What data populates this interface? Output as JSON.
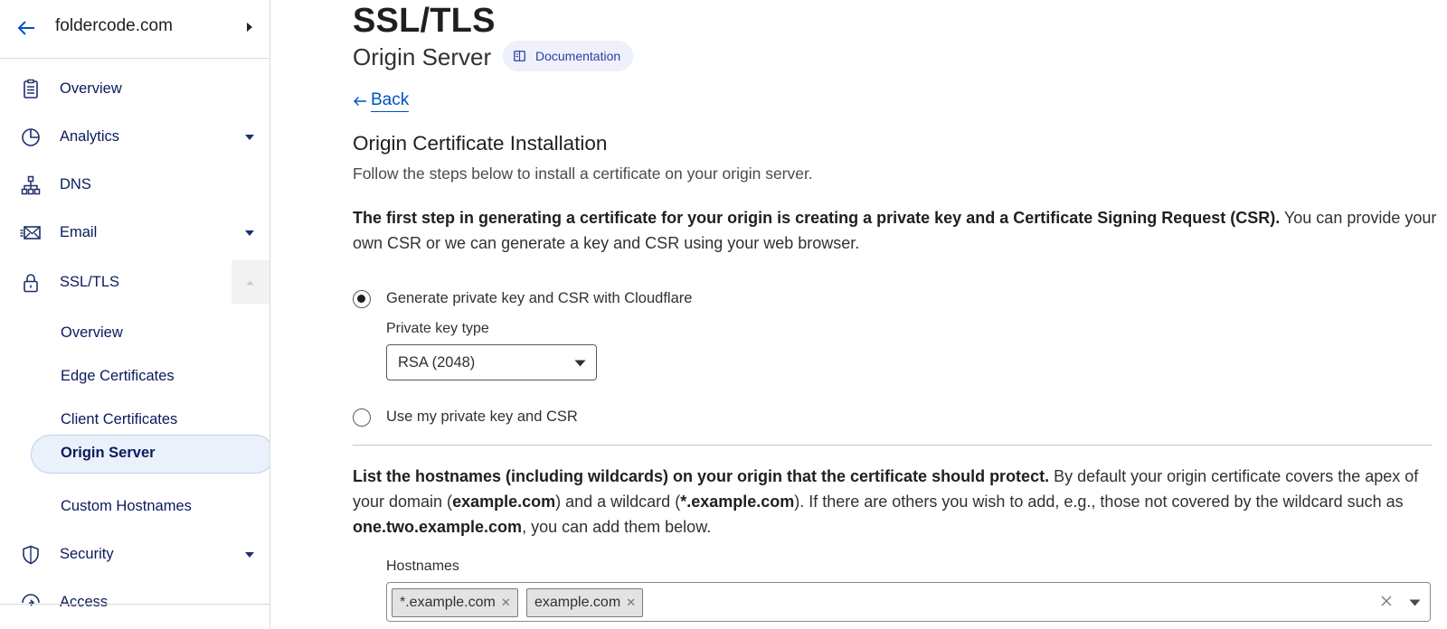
{
  "sidebar": {
    "zone_name": "foldercode.com",
    "items": [
      {
        "label": "Overview",
        "icon": "document-icon"
      },
      {
        "label": "Analytics",
        "icon": "pie-chart-icon"
      },
      {
        "label": "DNS",
        "icon": "network-icon"
      },
      {
        "label": "Email",
        "icon": "mail-icon"
      },
      {
        "label": "SSL/TLS",
        "icon": "lock-icon"
      },
      {
        "label": "Security",
        "icon": "shield-icon"
      },
      {
        "label": "Access",
        "icon": "access-icon"
      }
    ],
    "ssl_subitems": [
      {
        "label": "Overview"
      },
      {
        "label": "Edge Certificates"
      },
      {
        "label": "Client Certificates"
      },
      {
        "label": "Origin Server"
      },
      {
        "label": "Custom Hostnames"
      }
    ],
    "active_subitem": "Origin Server"
  },
  "header": {
    "title": "SSL/TLS",
    "subtitle": "Origin Server",
    "doc_badge": "Documentation"
  },
  "main": {
    "back_label": "Back",
    "section_title": "Origin Certificate Installation",
    "section_desc": "Follow the steps below to install a certificate on your origin server.",
    "step1_bold": "The first step in generating a certificate for your origin is creating a private key and a Certificate Signing Request (CSR).",
    "step1_rest": " You can provide your own CSR or we can generate a key and CSR using your web browser.",
    "radio_generate": "Generate private key and CSR with Cloudflare",
    "private_key_label": "Private key type",
    "private_key_value": "RSA (2048)",
    "radio_own": "Use my private key and CSR",
    "hostnames_p": {
      "bold1": "List the hostnames (including wildcards) on your origin that the certificate should protect.",
      "t1": " By default your origin certificate covers the apex of your domain (",
      "bold2": "example.com",
      "t2": ") and a wildcard (",
      "bold3": "*.example.com",
      "t3": "). If there are others you wish to add, e.g., those not covered by the wildcard such as ",
      "bold4": "one.two.example.com",
      "t4": ", you can add them below."
    },
    "hostnames_label": "Hostnames",
    "hostnames_tags": [
      "*.example.com",
      "example.com"
    ]
  },
  "colors": {
    "nav_text": "#0a1a5c",
    "link": "#0051c3",
    "active_bg": "#eaf1fb",
    "badge_bg": "#eef0fb"
  }
}
